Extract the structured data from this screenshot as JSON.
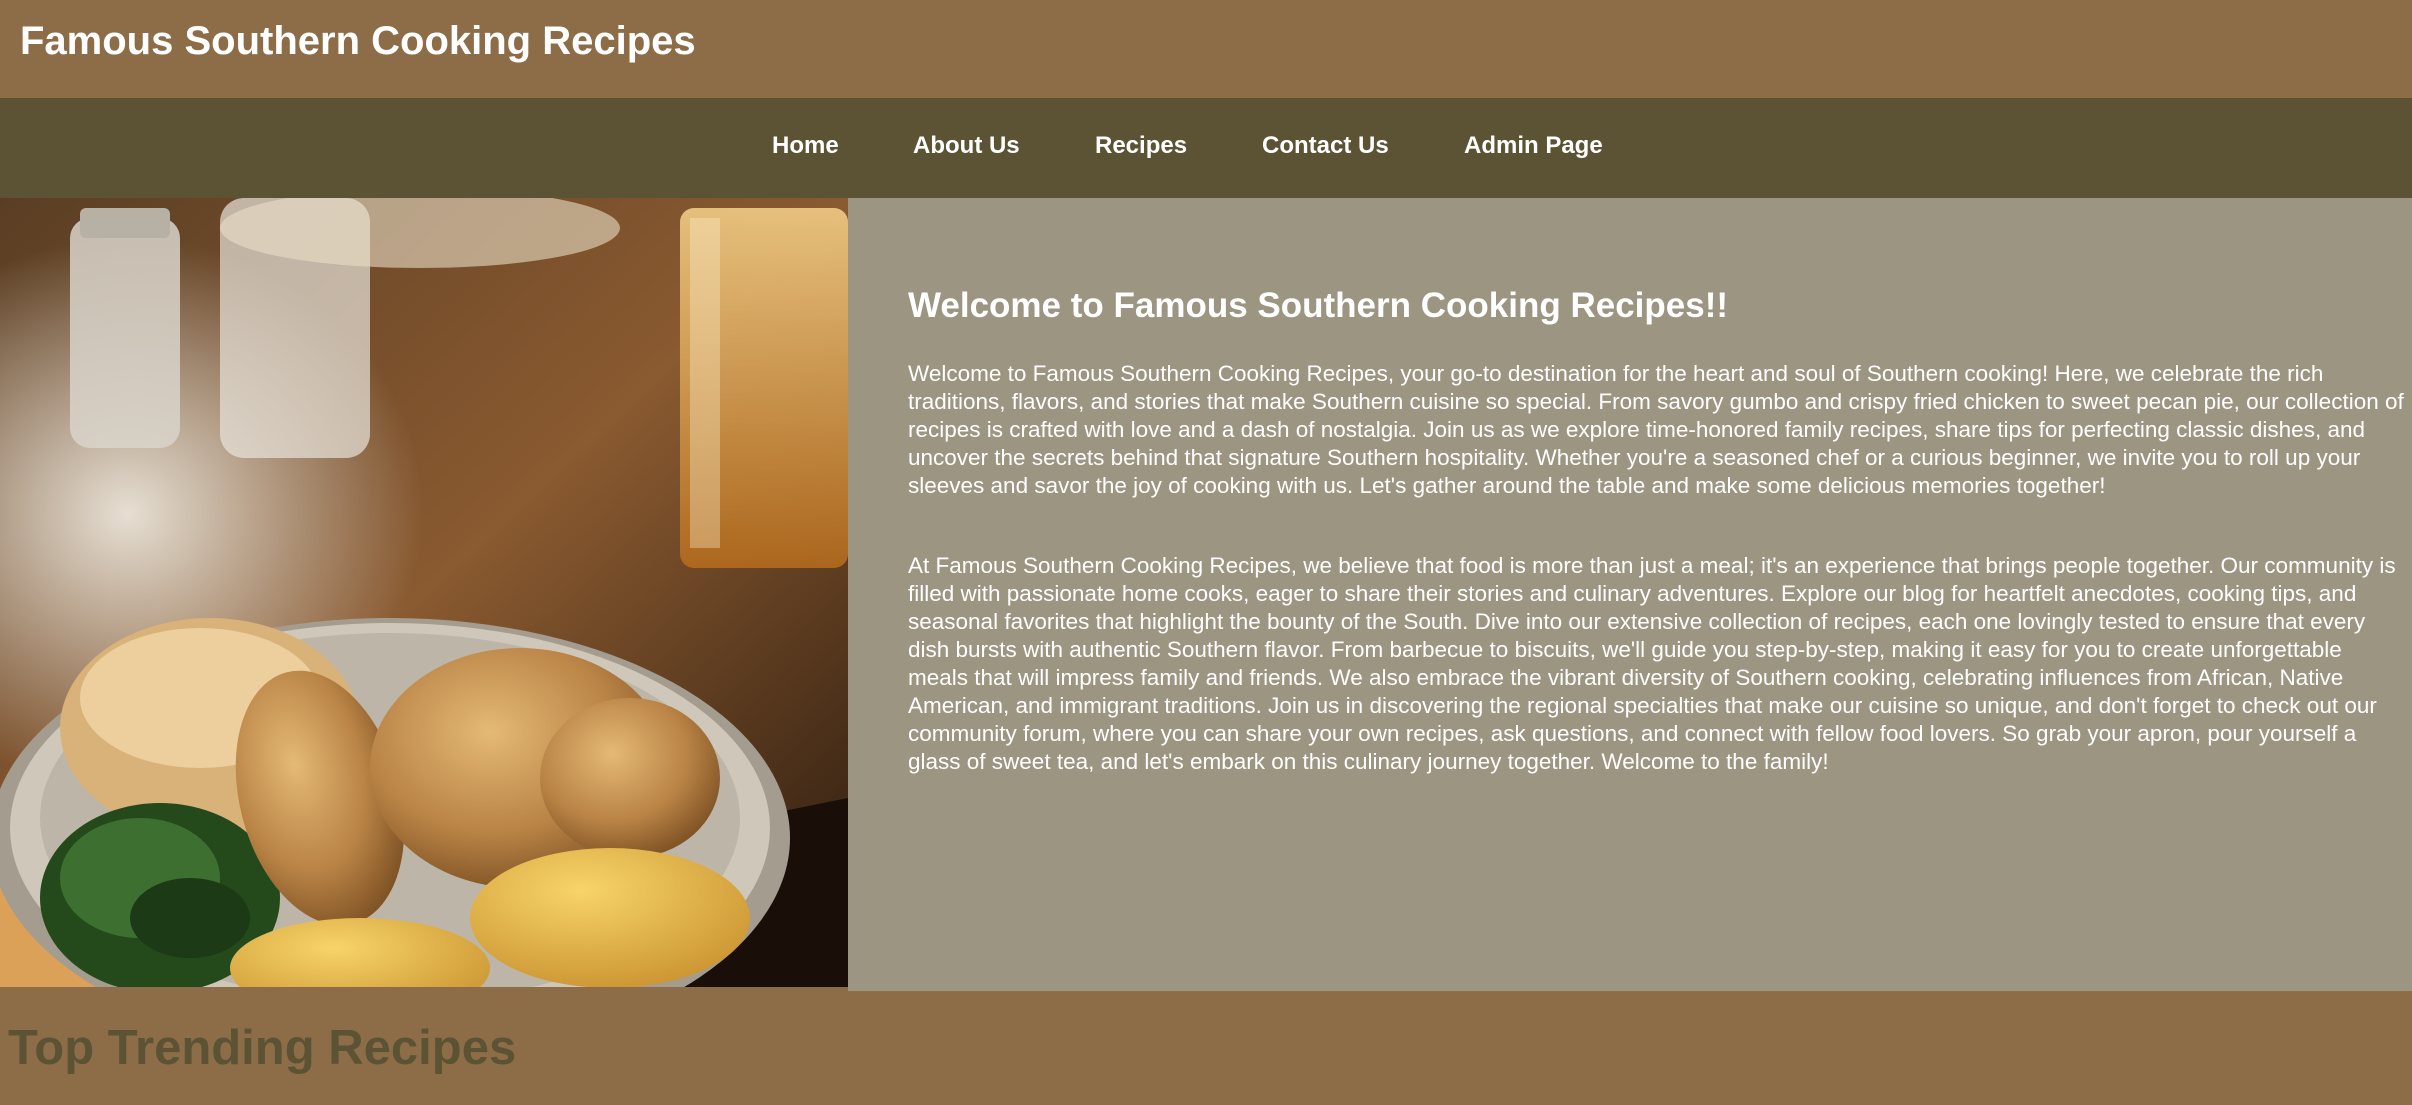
{
  "header": {
    "site_title": "Famous Southern Cooking Recipes"
  },
  "nav": {
    "items": [
      {
        "label": "Home"
      },
      {
        "label": "About Us"
      },
      {
        "label": "Recipes"
      },
      {
        "label": "Contact Us"
      },
      {
        "label": "Admin Page"
      }
    ]
  },
  "hero": {
    "image_subject": "fried chicken plate with collard greens, fried green tomatoes and biscuits"
  },
  "welcome": {
    "heading": "Welcome to Famous Southern Cooking Recipes!!",
    "paragraphs": [
      "Welcome to Famous Southern Cooking Recipes, your go-to destination for the heart and soul of Southern cooking! Here, we celebrate the rich traditions, flavors, and stories that make Southern cuisine so special. From savory gumbo and crispy fried chicken to sweet pecan pie, our collection of recipes is crafted with love and a dash of nostalgia. Join us as we explore time-honored family recipes, share tips for perfecting classic dishes, and uncover the secrets behind that signature Southern hospitality. Whether you're a seasoned chef or a curious beginner, we invite you to roll up your sleeves and savor the joy of cooking with us. Let's gather around the table and make some delicious memories together!",
      "At Famous Southern Cooking Recipes, we believe that food is more than just a meal; it's an experience that brings people together. Our community is filled with passionate home cooks, eager to share their stories and culinary adventures. Explore our blog for heartfelt anecdotes, cooking tips, and seasonal favorites that highlight the bounty of the South. Dive into our extensive collection of recipes, each one lovingly tested to ensure that every dish bursts with authentic Southern flavor. From barbecue to biscuits, we'll guide you step-by-step, making it easy for you to create unforgettable meals that will impress family and friends. We also embrace the vibrant diversity of Southern cooking, celebrating influences from African, Native American, and immigrant traditions. Join us in discovering the regional specialties that make our cuisine so unique, and don't forget to check out our community forum, where you can share your own recipes, ask questions, and connect with fellow food lovers. So grab your apron, pour yourself a glass of sweet tea, and let's embark on this culinary journey together. Welcome to the family!"
    ]
  },
  "trending": {
    "heading": "Top Trending Recipes"
  },
  "colors": {
    "header_bg": "#8c6d48",
    "nav_bg": "#5c5234",
    "panel_bg": "#9c9582",
    "text_light": "#ffffff",
    "trending_text": "#5c5234"
  }
}
